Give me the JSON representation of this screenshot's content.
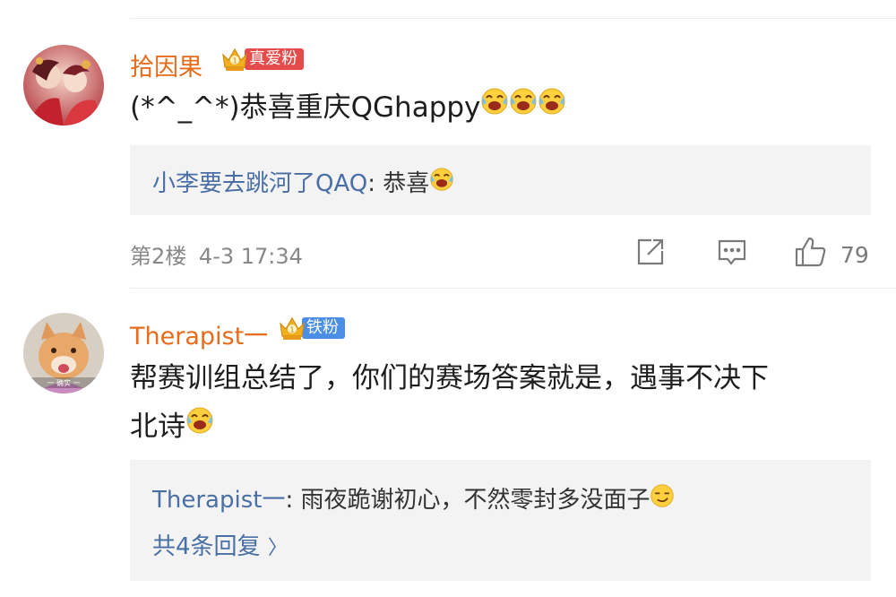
{
  "comments": [
    {
      "username": "拾因果",
      "badge": "真爱粉",
      "badge_color": "#e64b4b",
      "text": "(*^_^*)恭喜重庆QGhappy",
      "emoji_count": 3,
      "emoji_icon": "crying-laugh-emoji",
      "reply": {
        "name": "小李要去跳河了QAQ",
        "text": ": 恭喜"
      },
      "floor": "第2楼",
      "time": "4-3 17:34",
      "likes": "79"
    },
    {
      "username": "Therapist一",
      "badge": "铁粉",
      "badge_color": "#4b8ee6",
      "text_line1": "帮赛训组总结了，你们的赛场答案就是，遇事不决下",
      "text_line2": "北诗",
      "emoji_icon": "crying-laugh-emoji",
      "reply": {
        "name": "Therapist一",
        "text": ": 雨夜跪谢初心，不然零封多没面子"
      },
      "more_replies": "共4条回复 ",
      "more_replies_chevron": "〉"
    }
  ],
  "colors": {
    "username": "#e86b1a",
    "reply_name": "#4a6fa5",
    "reply_bg": "#f3f3f3",
    "meta": "#888888"
  }
}
